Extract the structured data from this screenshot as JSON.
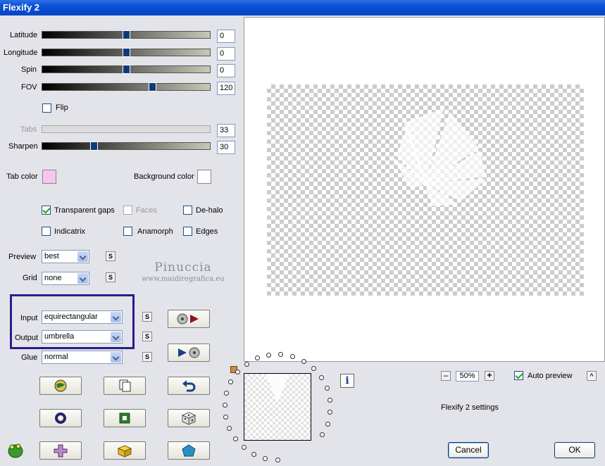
{
  "window": {
    "title": "Flexify 2"
  },
  "sliders": {
    "latitude": {
      "label": "Latitude",
      "value": "0",
      "fraction": 0.5
    },
    "longitude": {
      "label": "Longitude",
      "value": "0",
      "fraction": 0.5
    },
    "spin": {
      "label": "Spin",
      "value": "0",
      "fraction": 0.5
    },
    "fov": {
      "label": "FOV",
      "value": "120",
      "fraction": 0.667
    },
    "tabs": {
      "label": "Tabs",
      "value": "33"
    },
    "sharpen": {
      "label": "Sharpen",
      "value": "30",
      "fraction": 0.3
    }
  },
  "flip": {
    "label": "Flip",
    "checked": false
  },
  "colors": {
    "tab_color": {
      "label": "Tab color",
      "value": "#f7c6ec"
    },
    "background_color": {
      "label": "Background color",
      "value": "#ffffff"
    }
  },
  "options": {
    "transparent_gaps": {
      "label": "Transparent gaps",
      "checked": true
    },
    "faces": {
      "label": "Faces",
      "checked": false
    },
    "de_halo": {
      "label": "De-halo",
      "checked": false
    },
    "indicatrix": {
      "label": "Indicatrix",
      "checked": false
    },
    "anamorph": {
      "label": "Anamorph",
      "checked": false
    },
    "edges": {
      "label": "Edges",
      "checked": false
    }
  },
  "dropdowns": {
    "preview": {
      "label": "Preview",
      "value": "best"
    },
    "grid": {
      "label": "Grid",
      "value": "none"
    },
    "input": {
      "label": "Input",
      "value": "equirectangular"
    },
    "output": {
      "label": "Output",
      "value": "umbrella"
    },
    "glue": {
      "label": "Glue",
      "value": "normal"
    }
  },
  "s_button_label": "S",
  "watermark": {
    "name": "Pinuccia",
    "url": "www.maidiregrafica.eu"
  },
  "zoom": {
    "value": "50%",
    "minus": "–",
    "plus": "+"
  },
  "auto_preview": {
    "label": "Auto preview",
    "checked": true
  },
  "settings_label": "Flexify 2 settings",
  "buttons": {
    "cancel": "Cancel",
    "ok": "OK",
    "info": "i",
    "collapse": "^"
  },
  "accent_colors": {
    "highlight_frame": "#2b1b8e",
    "title_bar": "#0a4fd6"
  }
}
